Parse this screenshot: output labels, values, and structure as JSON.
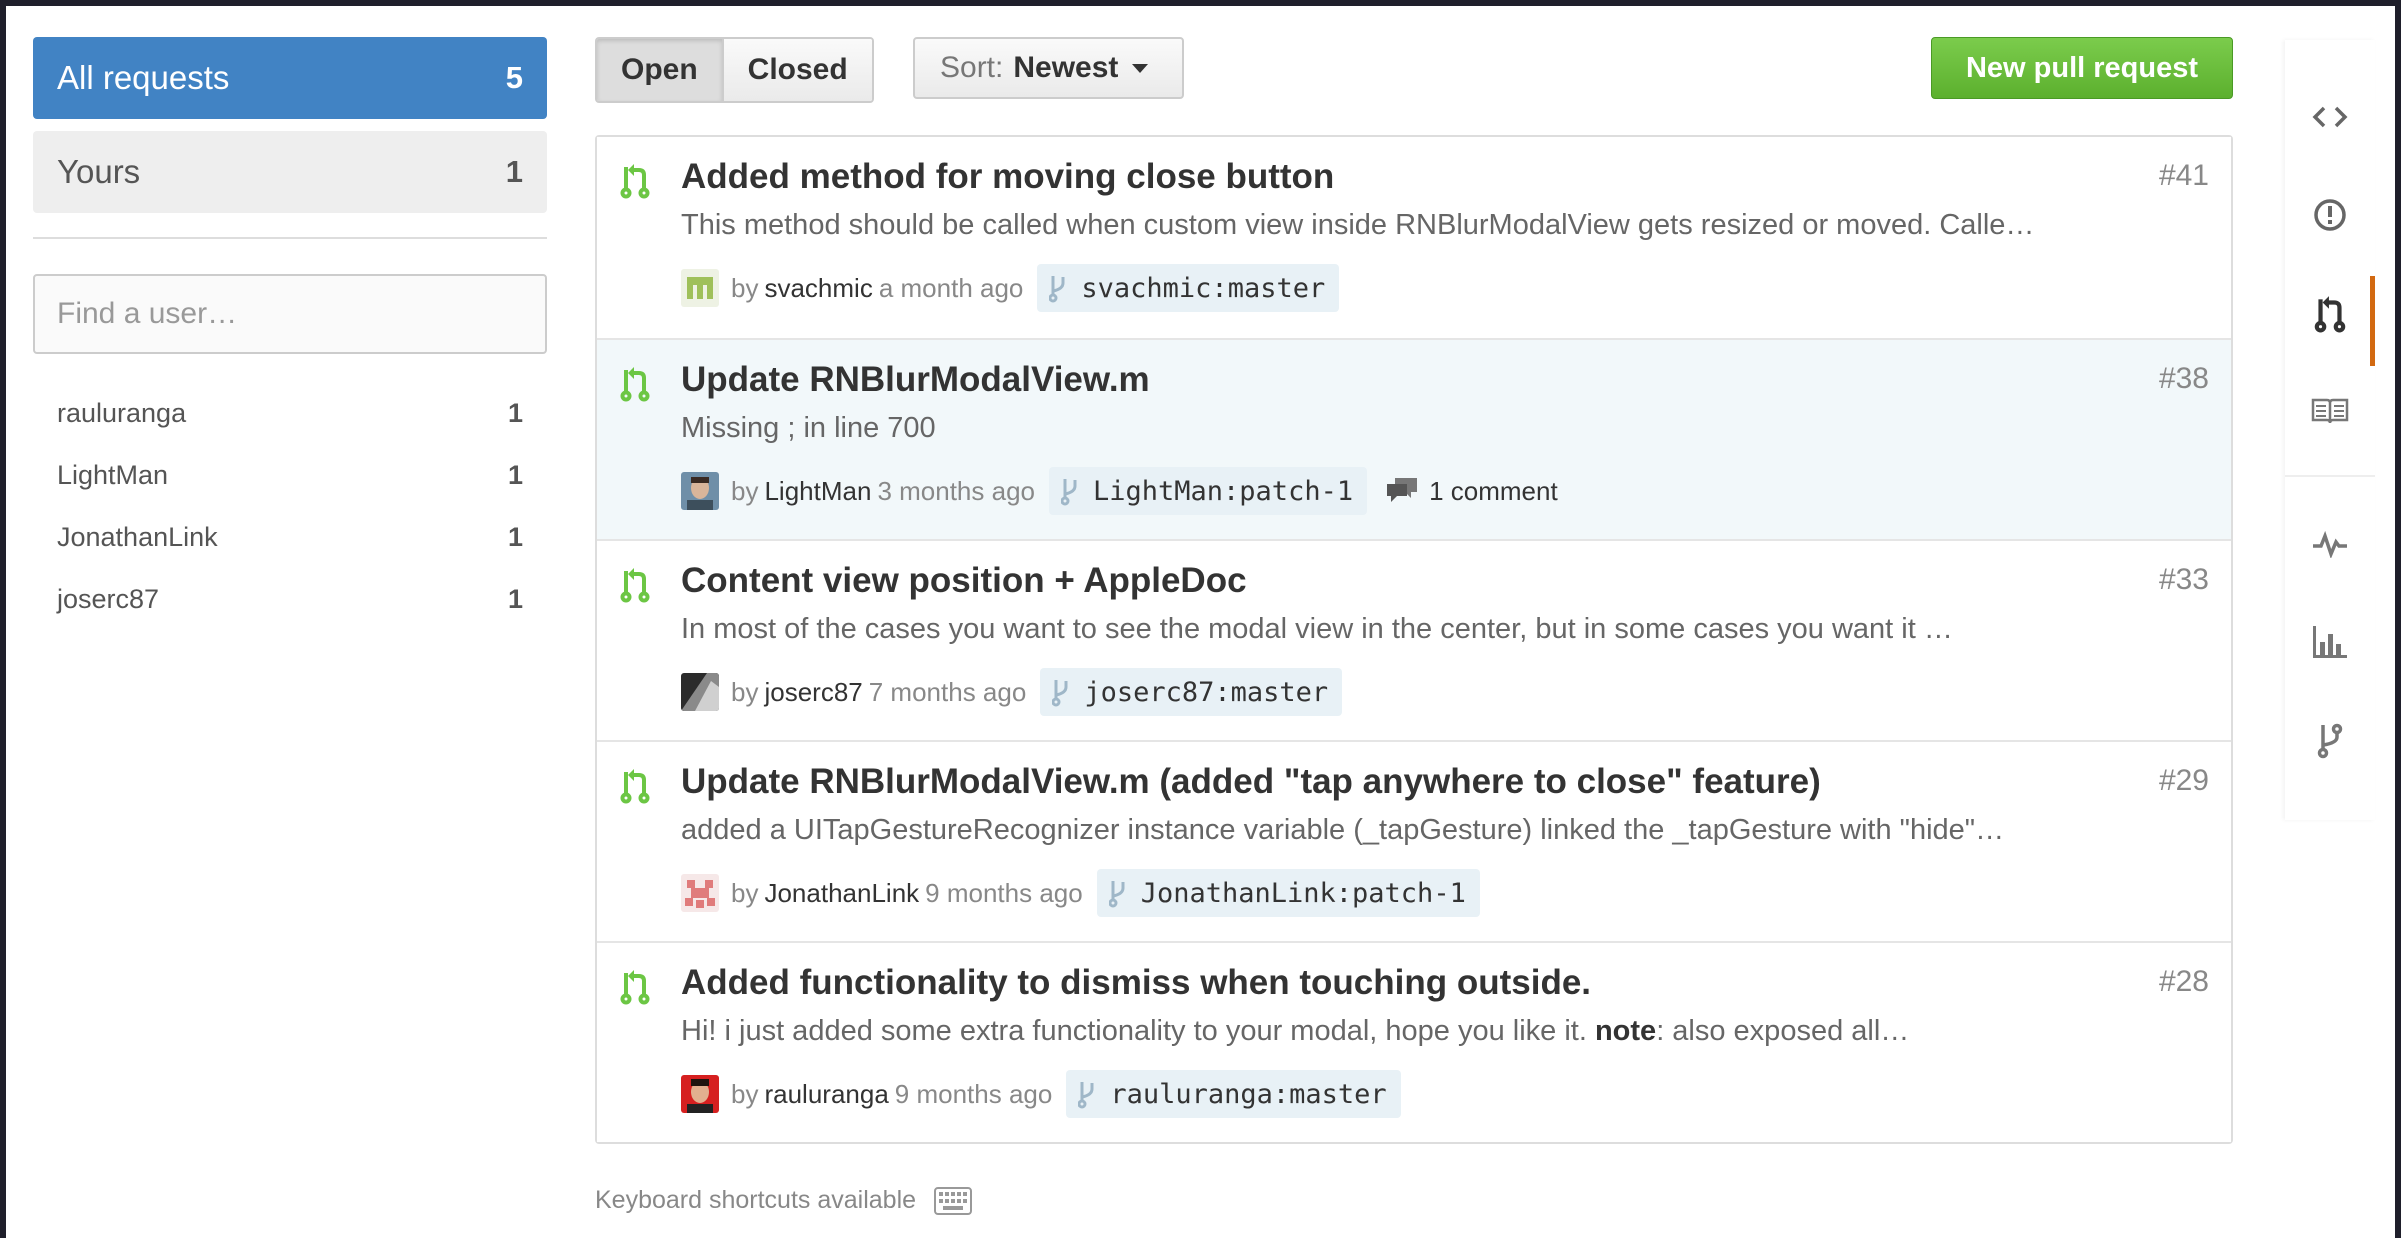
{
  "sidebar": {
    "filters": [
      {
        "label": "All requests",
        "count": "5"
      },
      {
        "label": "Yours",
        "count": "1"
      }
    ],
    "user_search_placeholder": "Find a user…",
    "users": [
      {
        "name": "rauluranga",
        "count": "1"
      },
      {
        "name": "LightMan",
        "count": "1"
      },
      {
        "name": "JonathanLink",
        "count": "1"
      },
      {
        "name": "joserc87",
        "count": "1"
      }
    ]
  },
  "toolbar": {
    "open_label": "Open",
    "closed_label": "Closed",
    "sort_prefix": "Sort:",
    "sort_value": "Newest",
    "new_pr_label": "New pull request"
  },
  "pull_requests": [
    {
      "title": "Added method for moving close button",
      "number": "#41",
      "description": "This method should be called when custom view inside RNBlurModalView gets resized or moved. Calle…",
      "by": "by",
      "author": "svachmic",
      "time": "a month ago",
      "branch": "svachmic:master",
      "comments": ""
    },
    {
      "title": "Update RNBlurModalView.m",
      "number": "#38",
      "description": "Missing ; in line 700",
      "by": "by",
      "author": "LightMan",
      "time": "3 months ago",
      "branch": "LightMan:patch-1",
      "comments": "1 comment"
    },
    {
      "title": "Content view position + AppleDoc",
      "number": "#33",
      "description": "In most of the cases you want to see the modal view in the center, but in some cases you want it …",
      "by": "by",
      "author": "joserc87",
      "time": "7 months ago",
      "branch": "joserc87:master",
      "comments": ""
    },
    {
      "title": "Update RNBlurModalView.m (added \"tap anywhere to close\" feature)",
      "number": "#29",
      "description": "added a UITapGestureRecognizer instance variable (_tapGesture) linked the _tapGesture with \"hide\"…",
      "by": "by",
      "author": "JonathanLink",
      "time": "9 months ago",
      "branch": "JonathanLink:patch-1",
      "comments": ""
    },
    {
      "title": "Added functionality to dismiss when touching outside.",
      "number": "#28",
      "description_before": "Hi! i just added some extra functionality to your modal, hope you like it. ",
      "description_bold": "note",
      "description_after": ": also exposed all…",
      "by": "by",
      "author": "rauluranga",
      "time": "9 months ago",
      "branch": "rauluranga:master",
      "comments": ""
    }
  ],
  "footer": {
    "shortcuts_label": "Keyboard shortcuts available"
  },
  "right_nav": {
    "items": [
      "code-icon",
      "issues-icon",
      "pull-request-icon",
      "wiki-icon",
      "pulse-icon",
      "graphs-icon",
      "network-icon"
    ],
    "selected": "pull-request-icon"
  },
  "colors": {
    "accent": "#4183c4",
    "green": "#6cc644",
    "nav_selected": "#d26911"
  }
}
